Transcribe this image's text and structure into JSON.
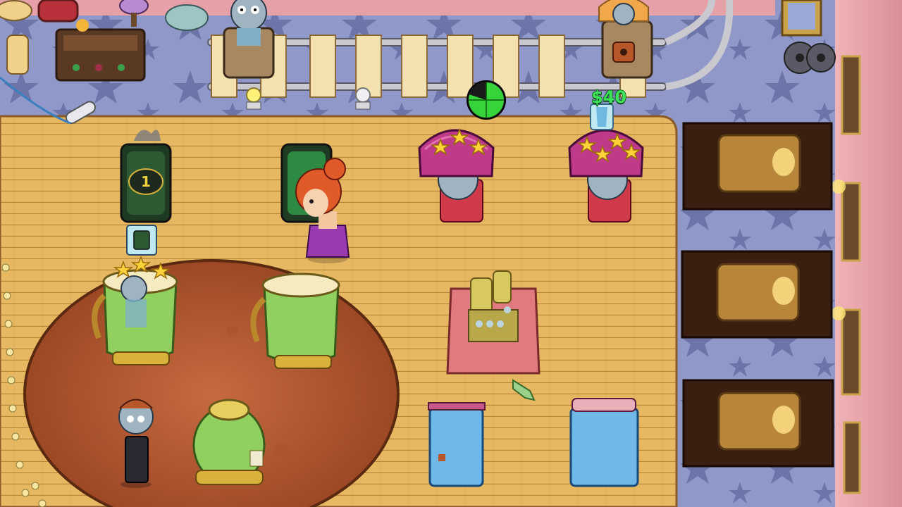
{
  "hud": {
    "customer_price": "$40",
    "station_number": "1"
  },
  "game": {
    "timer_progress": 0.8,
    "customers": [
      {
        "id": "zombie-girl-left",
        "stars": 3
      },
      {
        "id": "zombie-girl-right",
        "stars": 4
      },
      {
        "id": "zombie-in-tank",
        "stars": 3
      }
    ],
    "colors": {
      "floor": "#e3b35f",
      "carpet": "#8b93c4",
      "wall": "#e8a0a8",
      "timer_green": "#37d33a",
      "money_green": "#3fe35a"
    }
  }
}
